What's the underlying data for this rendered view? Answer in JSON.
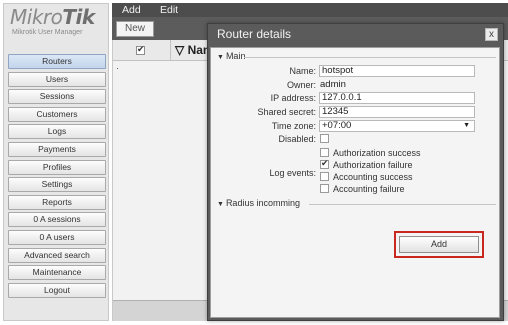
{
  "logo": {
    "brand_light": "Mikro",
    "brand_bold": "Tik",
    "subtitle": "Mikrotik User Manager"
  },
  "sidebar": {
    "items": [
      {
        "label": "Routers"
      },
      {
        "label": "Users"
      },
      {
        "label": "Sessions"
      },
      {
        "label": "Customers"
      },
      {
        "label": "Logs"
      },
      {
        "label": "Payments"
      },
      {
        "label": "Profiles"
      },
      {
        "label": "Settings"
      },
      {
        "label": "Reports"
      },
      {
        "label": "0 A sessions"
      },
      {
        "label": "0 A users"
      },
      {
        "label": "Advanced search"
      },
      {
        "label": "Maintenance"
      },
      {
        "label": "Logout"
      }
    ]
  },
  "toolbar": {
    "menu": [
      {
        "label": "Add"
      },
      {
        "label": "Edit"
      }
    ],
    "new_label": "New"
  },
  "grid": {
    "name_header": "Nam",
    "sort_icon": "▽",
    "row_marker": "·"
  },
  "dialog": {
    "title": "Router details",
    "close_label": "x",
    "main_section": "Main",
    "radius_section": "Radius incomming",
    "fields": {
      "name": {
        "label": "Name:",
        "value": "hotspot"
      },
      "owner": {
        "label": "Owner:",
        "value": "admin"
      },
      "ip": {
        "label": "IP address:",
        "value": "127.0.0.1"
      },
      "secret": {
        "label": "Shared secret:",
        "value": "12345"
      },
      "timezone": {
        "label": "Time zone:",
        "value": "+07:00"
      },
      "disabled": {
        "label": "Disabled:"
      },
      "log_events": {
        "label": "Log events:",
        "options": [
          {
            "label": "Authorization success",
            "checked": false
          },
          {
            "label": "Authorization failure",
            "checked": true
          },
          {
            "label": "Accounting success",
            "checked": false
          },
          {
            "label": "Accounting failure",
            "checked": false
          }
        ]
      }
    },
    "add_label": "Add"
  },
  "colors": {
    "highlight": "#c8281e",
    "titlebar": "#5b5b5b",
    "toolbar": "#4d4d4d"
  },
  "icons": {
    "close": "close-icon",
    "dropdown": "chevron-down-icon",
    "section_toggle": "triangle-down-icon"
  }
}
